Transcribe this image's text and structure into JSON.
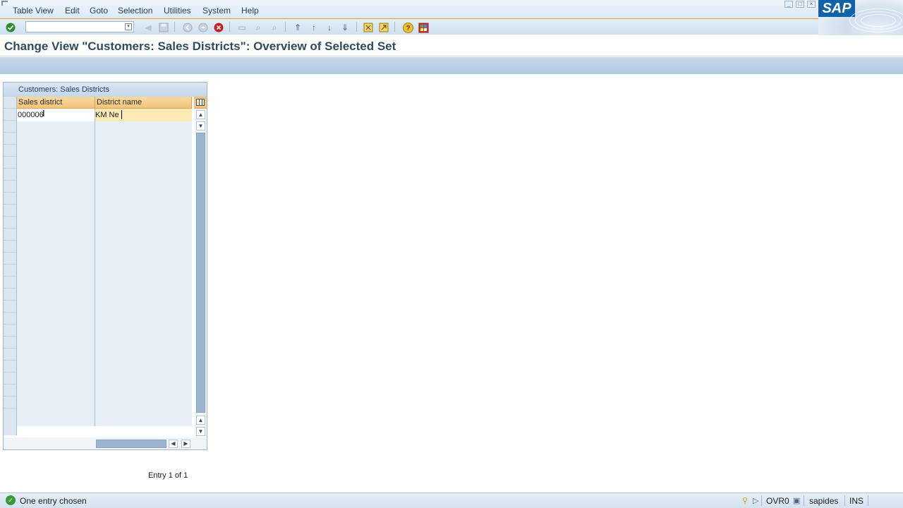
{
  "menu": {
    "items": [
      "Table View",
      "Edit",
      "Goto",
      "Selection",
      "Utilities",
      "System",
      "Help"
    ]
  },
  "toolbar": {
    "command_value": "",
    "icons": [
      "enter-icon",
      "back-icon",
      "save-icon",
      "exit-icon",
      "cancel-icon",
      "print-icon",
      "find-icon",
      "find-next-icon",
      "first-page-icon",
      "previous-page-icon",
      "next-page-icon",
      "last-page-icon",
      "create-session-icon",
      "shortcut-icon",
      "help-icon",
      "customize-layout-icon"
    ]
  },
  "logo": {
    "text": "SAP"
  },
  "title": "Change View \"Customers: Sales Districts\": Overview of Selected Set",
  "table": {
    "title": "Customers: Sales Districts",
    "columns": [
      "Sales district",
      "District name"
    ],
    "rows": [
      {
        "sales_district": "000006",
        "district_name": "KM Ne"
      }
    ],
    "empty_row_count": 24
  },
  "entry_info": "Entry 1 of 1",
  "status": {
    "message": "One entry chosen",
    "mode": "OVR0",
    "user": "sapides",
    "insert_mode": "INS"
  },
  "colors": {
    "accent_orange": "#e89a3c",
    "header_orange": "#f1c47a",
    "title_blue": "#2f4a63",
    "sap_blue": "#0f63a6"
  }
}
